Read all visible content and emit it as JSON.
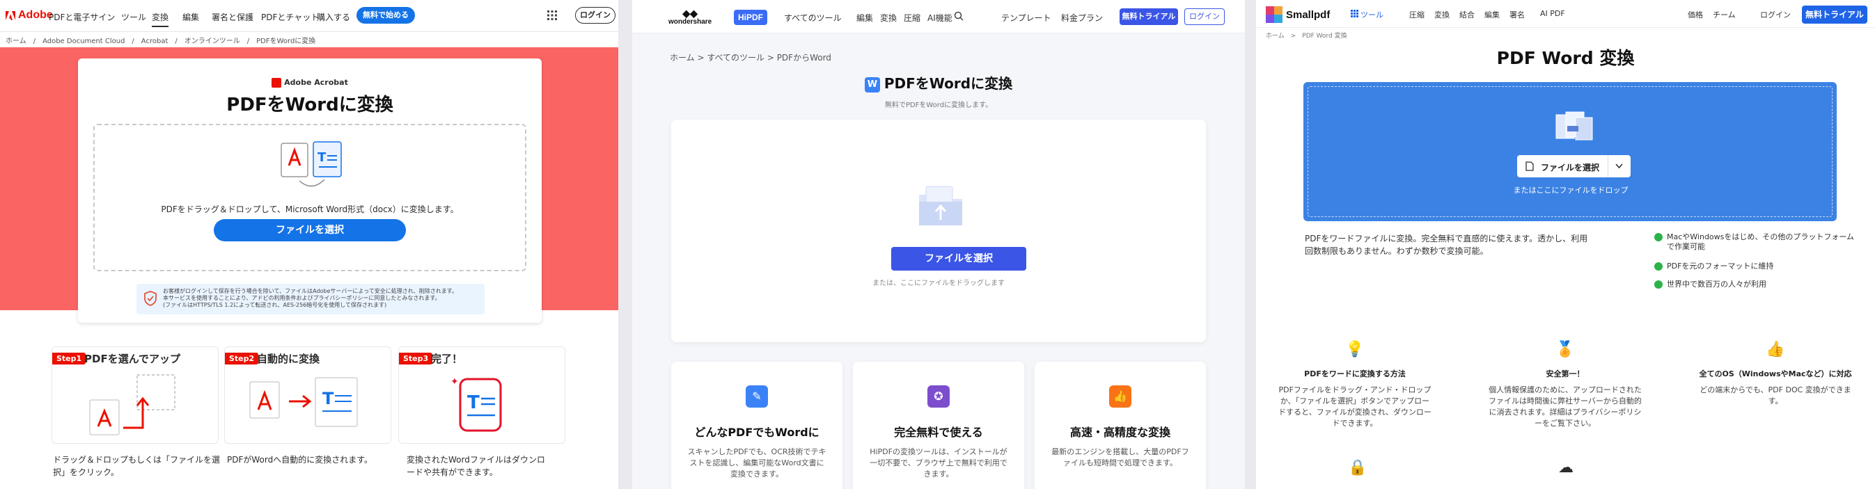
{
  "adobe": {
    "logo": "Adobe",
    "nav": [
      "PDFと電子サイン",
      "ツール",
      "変換",
      "編集",
      "署名と保護",
      "PDFとチャット",
      "購入する"
    ],
    "cta_top": "無料で始める",
    "login": "ログイン",
    "breadcrumb": "ホーム　/　Adobe Document Cloud　/　Acrobat　/　オンラインツール　/　PDFをWordに変換",
    "brand_small": "Adobe Acrobat",
    "title": "PDFをWordに変換",
    "drop_text": "PDFをドラッグ＆ドロップして、Microsoft Word形式（docx）に変換します。",
    "select_button": "ファイルを選択",
    "notice_line1": "お客様がログインして保存を行う場合を除いて、ファイルはAdobeサーバーによって安全に処理され、削除されます。",
    "notice_line2": "本サービスを使用することにより、アドビの利用条件およびプライバシーポリシーに同意したとみなされます。",
    "notice_line3": "(ファイルはHTTPS/TLS 1.2によって転送され、AES-256暗号化を使用して保存されます)",
    "steps": [
      {
        "tag": "Step1",
        "title": "PDFを選んでアップ",
        "desc": "ドラッグ＆ドロップもしくは「ファイルを選択」をクリック。"
      },
      {
        "tag": "Step2",
        "title": "自動的に変換",
        "desc": "PDFがWordへ自動的に変換されます。"
      },
      {
        "tag": "Step3",
        "title": "完了！",
        "desc": "変換されたWordファイルはダウンロードや共有ができます。"
      }
    ]
  },
  "hipdf": {
    "brand": "wondershare",
    "product": "HiPDF",
    "nav": [
      "すべてのツール",
      "編集",
      "変換",
      "圧縮",
      "AI機能"
    ],
    "nav_right": [
      "テンプレート",
      "料金プラン"
    ],
    "trial": "無料トライアル",
    "login": "ログイン",
    "breadcrumb": "ホーム > すべてのツール > PDFからWord",
    "title": "PDFをWordに変換",
    "subtitle": "無料でPDFをWordに変換します。",
    "select_button": "ファイルを選択",
    "hint": "または、ここにファイルをドラッグします",
    "features": [
      {
        "title": "どんなPDFでもWordに",
        "desc": "スキャンしたPDFでも、OCR技術でテキストを認識し、編集可能なWord文書に変換できます。",
        "color": "#3b82f6"
      },
      {
        "title": "完全無料で使える",
        "desc": "HiPDFの変換ツールは、インストールが一切不要で、ブラウザ上で無料で利用できます。",
        "color": "#7c4dcc"
      },
      {
        "title": "高速・高精度な変換",
        "desc": "最新のエンジンを搭載し、大量のPDFファイルも短時間で処理できます。",
        "color": "#f97316"
      }
    ]
  },
  "smallpdf": {
    "brand": "Smallpdf",
    "nav": [
      "ツール",
      "圧縮",
      "変換",
      "結合",
      "編集",
      "署名",
      "AI PDF"
    ],
    "nav_right": [
      "価格",
      "チーム",
      "ログイン"
    ],
    "cta_top": "無料トライアル",
    "breadcrumb": "ホーム　>　PDF Word 変換",
    "title": "PDF Word 変換",
    "choose_button": "ファイルを選択",
    "drop_hint": "またはここにファイルをドロップ",
    "intro": "PDFをワードファイルに変換。完全無料で直感的に使えます。透かし、利用回数制限もありません。わずか数秒で変換可能。",
    "checks": [
      "MacやWindowsをはじめ、その他のプラットフォームで作業可能",
      "PDFを元のフォーマットに維持",
      "世界中で数百万の人々が利用"
    ],
    "columns": [
      {
        "title": "PDFをワードに変換する方法",
        "desc": "PDFファイルをドラッグ・アンド・ドロップか、「ファイルを選択」ボタンでアップロードすると、ファイルが変換され、ダウンロードできます。"
      },
      {
        "title": "安全第一！",
        "desc": "個人情報保護のために、アップロードされたファイルは時間後に弊社サーバーから自動的に消去されます。詳細はプライバシーポリシーをご覧下さい。"
      },
      {
        "title": "全てのOS（WindowsやMacなど）に対応",
        "desc": "どの端末からでも、PDF DOC 変換ができます。"
      }
    ],
    "accent": "#1f64e7",
    "drop_color": "#3b82e4"
  }
}
